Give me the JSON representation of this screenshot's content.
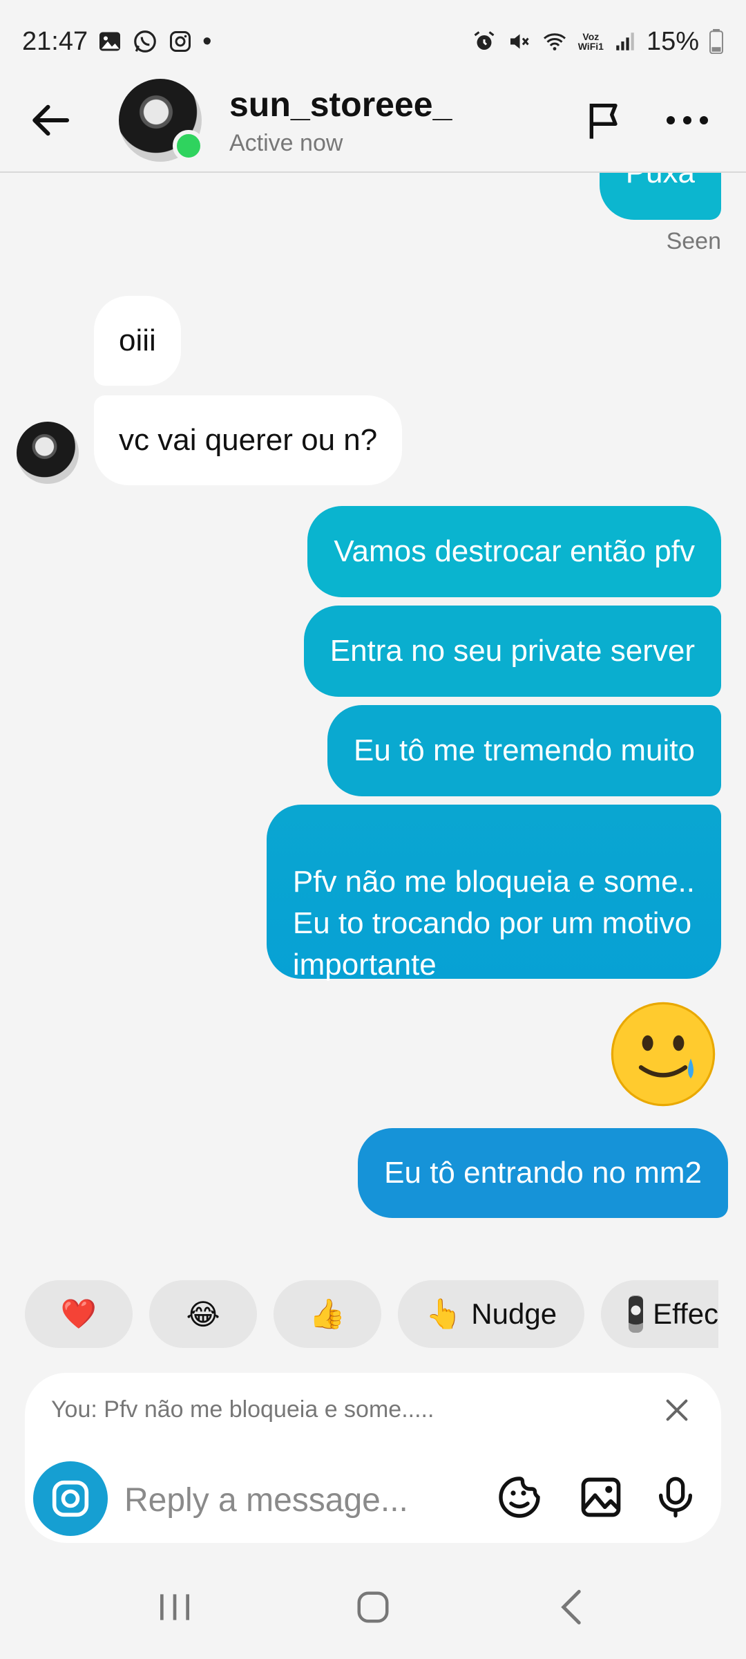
{
  "status_bar": {
    "time": "21:47",
    "dot": "•",
    "voz_wifi_top": "Voz",
    "voz_wifi_bottom": "WiFi1",
    "battery": "15%",
    "icons": [
      "gallery-icon",
      "whatsapp-icon",
      "instagram-icon",
      "alarm-icon",
      "mute-icon",
      "wifi-icon",
      "signal-icon",
      "battery-icon"
    ]
  },
  "header": {
    "name": "sun_storeee_",
    "status": "Active now",
    "online_color": "#2fd35e"
  },
  "messages": [
    {
      "side": "out",
      "text": "Puxa"
    },
    {
      "side": "in",
      "text": "oiii"
    },
    {
      "side": "in",
      "text": "vc vai querer ou n?"
    },
    {
      "side": "out",
      "text": "Vamos destrocar então pfv"
    },
    {
      "side": "out",
      "text": "Entra no seu private server"
    },
    {
      "side": "out",
      "text": "Eu tô me tremendo muito"
    },
    {
      "side": "out",
      "text": "Pfv não me bloqueia e some..\nEu to trocando por um motivo\nimportante"
    },
    {
      "side": "out",
      "emoji": "smiling-face-with-tear"
    },
    {
      "side": "out",
      "text": "Eu tô entrando no mm2"
    }
  ],
  "seen_label": "Seen",
  "reactions": [
    {
      "icon": "heart-emoji",
      "glyph": "❤️"
    },
    {
      "icon": "laughing-emoji",
      "glyph": "😂"
    },
    {
      "icon": "thumbs-up-emoji",
      "glyph": "👍"
    },
    {
      "icon": "pointing-hand-emoji",
      "glyph": "👆",
      "label": "Nudge"
    },
    {
      "icon": "effects-avatar",
      "label": "Effec"
    }
  ],
  "composer": {
    "reply_preview": "You: Pfv não me bloqueia e some.....",
    "placeholder": "Reply a message..."
  },
  "colors": {
    "outgoing_top": "#0cb6cf",
    "outgoing_bottom": "#1693d8",
    "incoming": "#ffffff",
    "background": "#f4f4f4"
  }
}
